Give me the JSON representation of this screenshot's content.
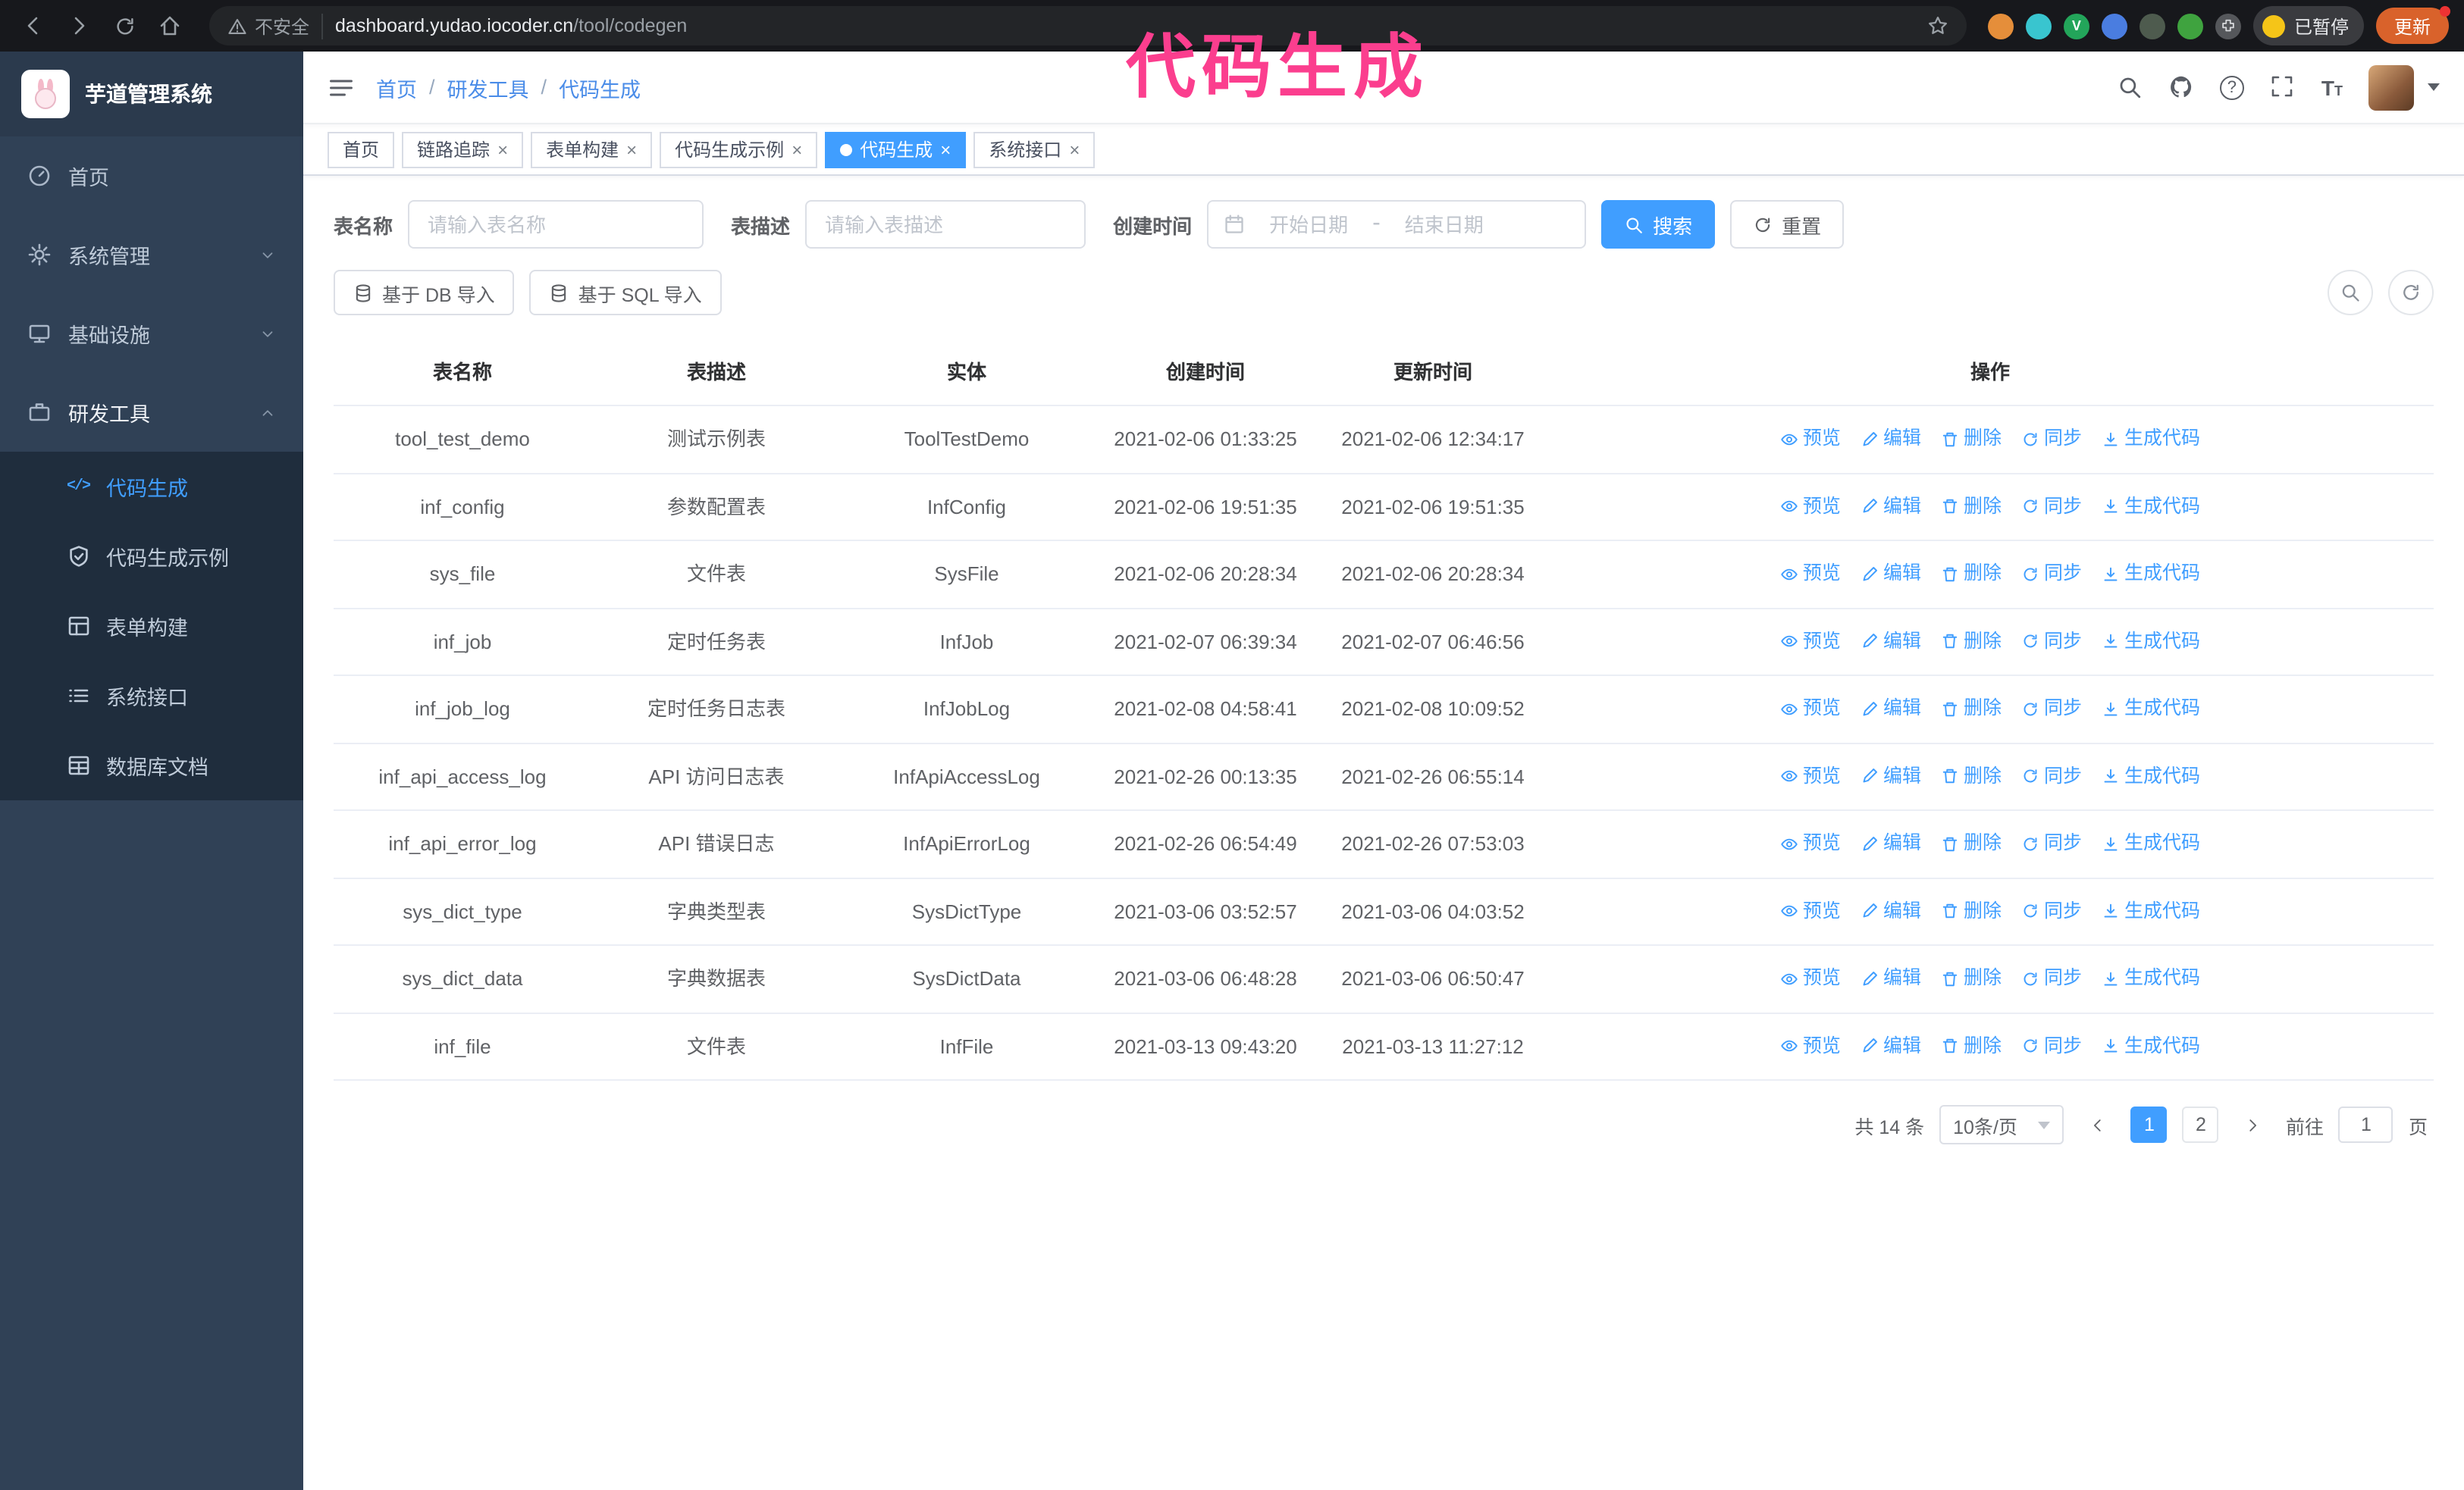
{
  "browser": {
    "security_label": "不安全",
    "url_host": "dashboard.yudao.iocoder.cn",
    "url_path": "/tool/codegen",
    "profile_badge": "已暂停",
    "update_button": "更新"
  },
  "annotation": {
    "text": "代码生成"
  },
  "icons": {
    "close": "×",
    "breadcrumb_separator": "/",
    "question": "?",
    "font_large": "T",
    "font_small": "T",
    "code_glyph": "</>"
  },
  "sidebar": {
    "logo_title": "芋道管理系统",
    "items": [
      {
        "label": "首页"
      },
      {
        "label": "系统管理"
      },
      {
        "label": "基础设施"
      },
      {
        "label": "研发工具"
      }
    ],
    "sub_items": [
      {
        "label": "代码生成"
      },
      {
        "label": "代码生成示例"
      },
      {
        "label": "表单构建"
      },
      {
        "label": "系统接口"
      },
      {
        "label": "数据库文档"
      }
    ]
  },
  "navbar": {
    "breadcrumb": [
      "首页",
      "研发工具",
      "代码生成"
    ]
  },
  "tabs": [
    {
      "label": "首页",
      "active": false,
      "closable": false
    },
    {
      "label": "链路追踪",
      "active": false,
      "closable": true
    },
    {
      "label": "表单构建",
      "active": false,
      "closable": true
    },
    {
      "label": "代码生成示例",
      "active": false,
      "closable": true
    },
    {
      "label": "代码生成",
      "active": true,
      "closable": true
    },
    {
      "label": "系统接口",
      "active": false,
      "closable": true
    }
  ],
  "search": {
    "name_label": "表名称",
    "name_placeholder": "请输入表名称",
    "desc_label": "表描述",
    "desc_placeholder": "请输入表描述",
    "time_label": "创建时间",
    "start_placeholder": "开始日期",
    "range_separator": "-",
    "end_placeholder": "结束日期",
    "search_button": "搜索",
    "reset_button": "重置"
  },
  "toolbar": {
    "import_db_button": "基于 DB 导入",
    "import_sql_button": "基于 SQL 导入"
  },
  "table": {
    "columns": [
      "表名称",
      "表描述",
      "实体",
      "创建时间",
      "更新时间",
      "操作"
    ],
    "actions": [
      "预览",
      "编辑",
      "删除",
      "同步",
      "生成代码"
    ],
    "rows": [
      {
        "name": "tool_test_demo",
        "desc": "测试示例表",
        "entity": "ToolTestDemo",
        "created": "2021-02-06 01:33:25",
        "updated": "2021-02-06 12:34:17"
      },
      {
        "name": "inf_config",
        "desc": "参数配置表",
        "entity": "InfConfig",
        "created": "2021-02-06 19:51:35",
        "updated": "2021-02-06 19:51:35"
      },
      {
        "name": "sys_file",
        "desc": "文件表",
        "entity": "SysFile",
        "created": "2021-02-06 20:28:34",
        "updated": "2021-02-06 20:28:34"
      },
      {
        "name": "inf_job",
        "desc": "定时任务表",
        "entity": "InfJob",
        "created": "2021-02-07 06:39:34",
        "updated": "2021-02-07 06:46:56"
      },
      {
        "name": "inf_job_log",
        "desc": "定时任务日志表",
        "entity": "InfJobLog",
        "created": "2021-02-08 04:58:41",
        "updated": "2021-02-08 10:09:52"
      },
      {
        "name": "inf_api_access_log",
        "desc": "API 访问日志表",
        "entity": "InfApiAccessLog",
        "created": "2021-02-26 00:13:35",
        "updated": "2021-02-26 06:55:14"
      },
      {
        "name": "inf_api_error_log",
        "desc": "API 错误日志",
        "entity": "InfApiErrorLog",
        "created": "2021-02-26 06:54:49",
        "updated": "2021-02-26 07:53:03"
      },
      {
        "name": "sys_dict_type",
        "desc": "字典类型表",
        "entity": "SysDictType",
        "created": "2021-03-06 03:52:57",
        "updated": "2021-03-06 04:03:52"
      },
      {
        "name": "sys_dict_data",
        "desc": "字典数据表",
        "entity": "SysDictData",
        "created": "2021-03-06 06:48:28",
        "updated": "2021-03-06 06:50:47"
      },
      {
        "name": "inf_file",
        "desc": "文件表",
        "entity": "InfFile",
        "created": "2021-03-13 09:43:20",
        "updated": "2021-03-13 11:27:12"
      }
    ]
  },
  "pagination": {
    "total_text": "共 14 条",
    "page_size": "10条/页",
    "pages": [
      "1",
      "2"
    ],
    "goto_label": "前往",
    "goto_value": "1",
    "goto_suffix": "页"
  }
}
